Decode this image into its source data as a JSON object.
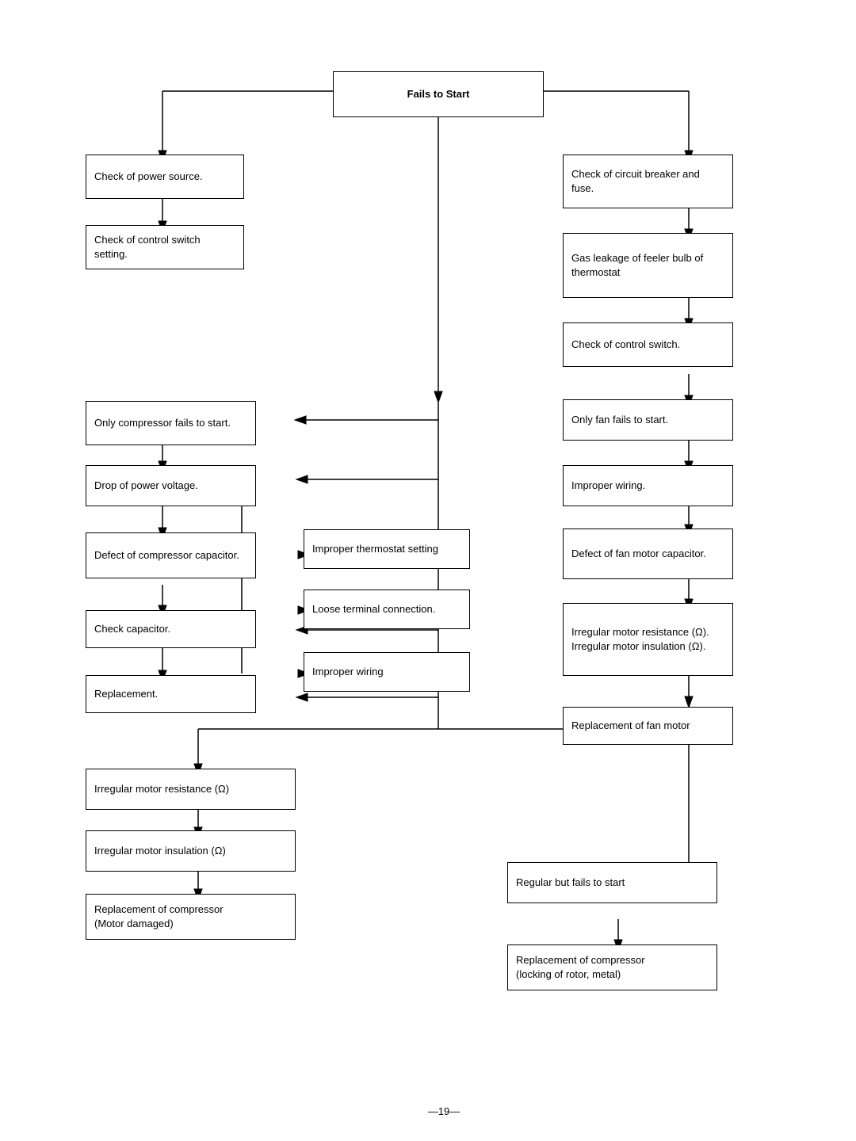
{
  "title": "Fails to Start",
  "nodes": {
    "fails_to_start": "Fails to Start",
    "check_power": "Check of power source.",
    "check_control_switch_setting": "Check of control switch setting.",
    "check_circuit_breaker": "Check of circuit breaker and fuse.",
    "gas_leakage": "Gas leakage of feeler bulb of thermostat",
    "check_control_switch": "Check of control switch.",
    "only_compressor": "Only compressor fails to start.",
    "only_fan": "Only fan fails to start.",
    "drop_power": "Drop of power voltage.",
    "improper_wiring_fan": "Improper wiring.",
    "defect_compressor_cap": "Defect of compressor capacitor.",
    "defect_fan_cap": "Defect of fan motor capacitor.",
    "check_capacitor": "Check capacitor.",
    "irregular_motor_res_fan": "Irregular motor resistance (Ω).\nIrregular motor insulation (Ω).",
    "replacement": "Replacement.",
    "replacement_fan_motor": "Replacement of fan motor",
    "improper_thermostat": "Improper thermostat setting",
    "loose_terminal": "Loose terminal connection.",
    "improper_wiring_mid": "Improper wiring",
    "irregular_motor_res": "Irregular motor resistance (Ω)",
    "irregular_motor_ins": "Irregular motor insulation (Ω)",
    "replacement_compressor_motor": "Replacement of compressor\n(Motor damaged)",
    "regular_fails": "Regular but fails to start",
    "replacement_compressor_rotor": "Replacement of compressor\n(locking of rotor, metal)"
  },
  "page_number": "—19—"
}
